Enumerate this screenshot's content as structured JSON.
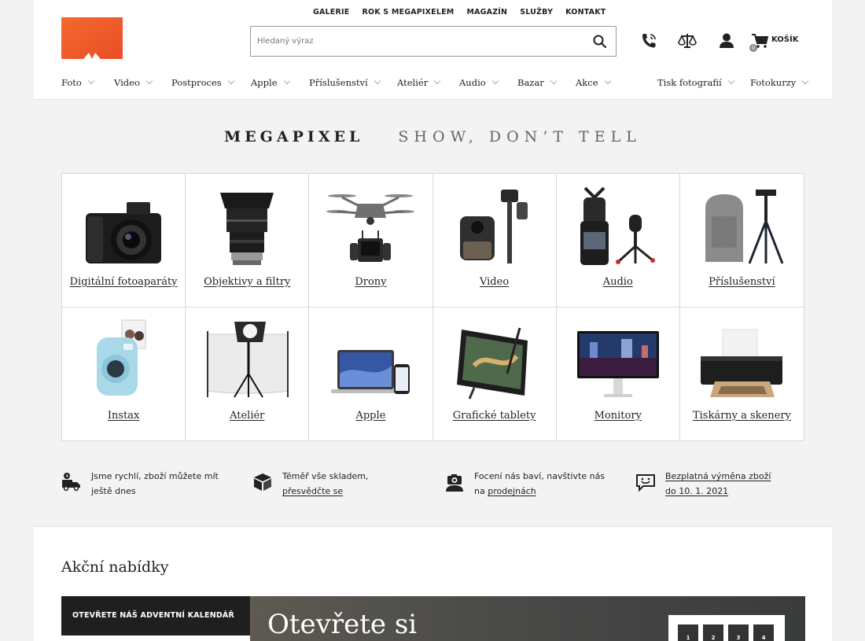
{
  "brand": {
    "logo_letter": "M",
    "color": "#f05a28"
  },
  "topnav": [
    "GALERIE",
    "ROK S MEGAPIXELEM",
    "MAGAZÍN",
    "SLUŽBY",
    "KONTAKT"
  ],
  "search": {
    "placeholder": "Hledaný výraz",
    "icon": "search-icon"
  },
  "header_icons": [
    "phone-icon",
    "compare-scales-icon",
    "user-icon",
    "cart-icon"
  ],
  "cart": {
    "label": "KOŠÍK",
    "count": "0"
  },
  "categories_nav": [
    "Foto",
    "Video",
    "Postproces",
    "Apple",
    "Příslušenství",
    "Ateliér",
    "Audio",
    "Bazar",
    "Akce",
    "Tisk fotografií",
    "Fotokurzy"
  ],
  "tagline": {
    "brand": "MEGAPIXEL",
    "slogan": "SHOW, DON’T TELL"
  },
  "tiles": [
    {
      "label": "Digitální fotoaparáty",
      "icon": "camera-icon"
    },
    {
      "label": "Objektivy a filtry",
      "icon": "lens-icon"
    },
    {
      "label": "Drony",
      "icon": "drone-icon"
    },
    {
      "label": "Video",
      "icon": "video-camera-icon"
    },
    {
      "label": "Audio",
      "icon": "audio-recorder-icon"
    },
    {
      "label": "Příslušenství",
      "icon": "bag-tripod-icon"
    },
    {
      "label": "Instax",
      "icon": "instax-camera-icon"
    },
    {
      "label": "Ateliér",
      "icon": "studio-light-icon"
    },
    {
      "label": "Apple",
      "icon": "laptop-phone-icon"
    },
    {
      "label": "Grafické tablety",
      "icon": "drawing-tablet-icon"
    },
    {
      "label": "Monitory",
      "icon": "monitor-icon"
    },
    {
      "label": "Tiskárny a skenery",
      "icon": "printer-icon"
    }
  ],
  "features": [
    {
      "icon": "delivery-truck-icon",
      "line1": "Jsme rychlí, zboží můžete mít",
      "line2": "ještě dnes",
      "link": ""
    },
    {
      "icon": "box-icon",
      "line1": "Téměř vše skladem,",
      "line2": "",
      "link": "přesvědčte se"
    },
    {
      "icon": "photographer-icon",
      "line1": "Focení nás baví, navštivte nás",
      "line2": "na ",
      "link": "prodejnách"
    },
    {
      "icon": "smile-chat-icon",
      "line1": "Bezplatná výměna zboží",
      "line2": "do 10. 1. 2021",
      "link": ""
    }
  ],
  "offers": {
    "title": "Akční nabídky",
    "side_label": "OTEVŘETE NÁŠ ADVENTNÍ KALENDÁŘ",
    "banner_heading": "Otevřete si",
    "calendar_days": [
      "1",
      "2",
      "3",
      "4"
    ]
  }
}
